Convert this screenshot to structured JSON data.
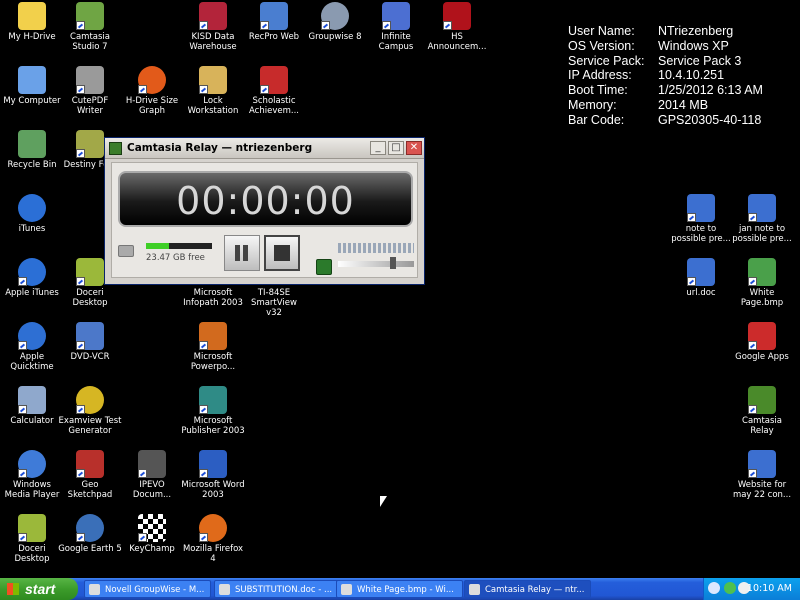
{
  "desktop": {
    "icons": [
      {
        "label": "My H-Drive",
        "color": "#f2d04b"
      },
      {
        "label": "Camtasia Studio 7",
        "color": "#6fa544"
      },
      {
        "label": "KISD Data Warehouse",
        "color": "#b3243a"
      },
      {
        "label": "RecPro Web",
        "color": "#4a7ed0"
      },
      {
        "label": "Groupwise 8",
        "color": "#8a9ab0"
      },
      {
        "label": "Infinite Campus",
        "color": "#4c6fd2"
      },
      {
        "label": "HS Announcem...",
        "color": "#b0121b"
      },
      {
        "label": "My Computer",
        "color": "#6aa1e8"
      },
      {
        "label": "CutePDF Writer",
        "color": "#9a9a9a"
      },
      {
        "label": "H-Drive Size Graph",
        "color": "#e25a1a"
      },
      {
        "label": "Lock Workstation",
        "color": "#d8b35a"
      },
      {
        "label": "Scholastic Achievem...",
        "color": "#c72b2b"
      },
      {
        "label": "Recycle Bin",
        "color": "#5fa05f"
      },
      {
        "label": "Destiny Fo...",
        "color": "#a2a848"
      },
      {
        "label": "iTunes",
        "color": "#2b6fd6"
      },
      {
        "label": "Apple iTunes",
        "color": "#2b6fd6"
      },
      {
        "label": "Doceri Desktop",
        "color": "#9bb83a"
      },
      {
        "label": "Microsoft Infopath 2003",
        "color": "#6a8fcf"
      },
      {
        "label": "TI-84SE SmartView v32",
        "color": "#777777"
      },
      {
        "label": "Apple Quicktime",
        "color": "#2e6fd3"
      },
      {
        "label": "DVD-VCR",
        "color": "#4c78c9"
      },
      {
        "label": "Microsoft Powerpo...",
        "color": "#d26a1e"
      },
      {
        "label": "Calculator",
        "color": "#8fa8cc"
      },
      {
        "label": "Examview Test Generator",
        "color": "#d6b623"
      },
      {
        "label": "Microsoft Publisher 2003",
        "color": "#2f8b86"
      },
      {
        "label": "Windows Media Player",
        "color": "#3f7bd8"
      },
      {
        "label": "Geo Sketchpad",
        "color": "#b8302b"
      },
      {
        "label": "IPEVO Docum...",
        "color": "#555555"
      },
      {
        "label": "Microsoft Word 2003",
        "color": "#2c5ec2"
      },
      {
        "label": "Doceri Desktop",
        "color": "#9bb83a"
      },
      {
        "label": "Google Earth 5",
        "color": "#3a6fb8"
      },
      {
        "label": "KeyChamp",
        "color": "#d0d0d0"
      },
      {
        "label": "Mozilla Firefox 4",
        "color": "#e06a1a"
      },
      {
        "label": "note to possible pre...",
        "color": "#3c6fd0"
      },
      {
        "label": "jan note to possible pre...",
        "color": "#3c6fd0"
      },
      {
        "label": "url.doc",
        "color": "#3c6fd0"
      },
      {
        "label": "White Page.bmp",
        "color": "#4aa04a"
      },
      {
        "label": "Google Apps",
        "color": "#cc2b2b"
      },
      {
        "label": "Camtasia Relay",
        "color": "#4a8a2a"
      },
      {
        "label": "Website for may 22 con...",
        "color": "#3c6fd0"
      }
    ]
  },
  "bginfo": {
    "rows": [
      {
        "key": "User Name:",
        "value": "NTriezenberg"
      },
      {
        "key": "OS Version:",
        "value": "Windows XP"
      },
      {
        "key": "Service Pack:",
        "value": "Service Pack 3"
      },
      {
        "key": "IP Address:",
        "value": "10.4.10.251"
      },
      {
        "key": "Boot Time:",
        "value": "1/25/2012 6:13 AM"
      },
      {
        "key": "Memory:",
        "value": "2014 MB"
      },
      {
        "key": "Bar Code:",
        "value": "GPS20305-40-118"
      }
    ]
  },
  "camtasia": {
    "title": "Camtasia Relay — ntriezenberg",
    "timer": "00:00:00",
    "disk_free": "23.47 GB free",
    "disk_level": 0.35,
    "minimize": "_",
    "maximize": "□",
    "close": "✕"
  },
  "taskbar": {
    "start_label": "start",
    "buttons": [
      {
        "label": "Novell GroupWise - M..."
      },
      {
        "label": "SUBSTITUTION.doc - ..."
      },
      {
        "label": "White Page.bmp - Wi..."
      },
      {
        "label": "Camtasia Relay — ntr..."
      }
    ],
    "clock": "10:10 AM"
  },
  "colors": {
    "desktop_bg": "#000000",
    "taskbar": "#245edb",
    "start": "#3c9c2b",
    "tray": "#0b7ed8"
  }
}
